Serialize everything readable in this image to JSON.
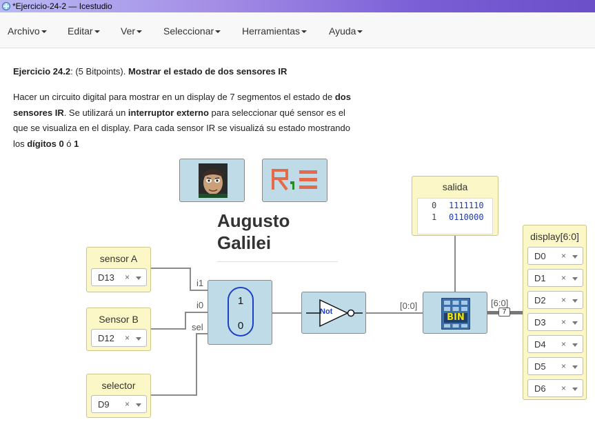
{
  "window": {
    "title": "*Ejercicio-24-2 — Icestudio"
  },
  "menu": [
    {
      "label": "Archivo"
    },
    {
      "label": "Editar"
    },
    {
      "label": "Ver"
    },
    {
      "label": "Seleccionar"
    },
    {
      "label": "Herramientas"
    },
    {
      "label": "Ayuda"
    }
  ],
  "info": {
    "heading_prefix": "Ejercicio 24.2",
    "heading_points": ": (5 Bitpoints). ",
    "heading_title": "Mostrar el estado de dos sensores IR",
    "p1": "Hacer un circuito digital para mostrar en un display de 7 segmentos el estado de ",
    "p2b": "dos sensores IR",
    "p3": ". Se utilizará un ",
    "p4b": "interruptor externo",
    "p5": " para seleccionar qué sensor es el que se visualiza en el display. Para cada sensor IR se visualizá su estado mostrando los ",
    "p6b": "dígitos 0",
    "p7": " ó ",
    "p8b": "1"
  },
  "author": {
    "line1": "Augusto",
    "line2": "Galilei"
  },
  "inputs": [
    {
      "label": "sensor A",
      "pin": "D13"
    },
    {
      "label": "Sensor B",
      "pin": "D12"
    },
    {
      "label": "selector",
      "pin": "D9"
    }
  ],
  "mux": {
    "port_i1": "i1",
    "port_i0": "i0",
    "port_sel": "sel",
    "top": "1",
    "bottom": "0"
  },
  "not_gate": {
    "label": "Not"
  },
  "bus_in_label": "[0:0]",
  "bus_out_label": "[6:0]",
  "bus_width": "7",
  "rom": {
    "label": "BIN"
  },
  "table": {
    "title": "salida",
    "rows": [
      {
        "addr": "0",
        "data": "1111110"
      },
      {
        "addr": "1",
        "data": "0110000"
      }
    ]
  },
  "output": {
    "label": "display[6:0]",
    "pins": [
      "D0",
      "D1",
      "D2",
      "D3",
      "D4",
      "D5",
      "D6"
    ]
  },
  "colors": {
    "block_blue": "#bfdbe8",
    "io_yellow": "#fcf7c6",
    "mux_border": "#1a3fc2",
    "not_label": "#1a3fc2",
    "bin_yellow": "#f2e400"
  }
}
